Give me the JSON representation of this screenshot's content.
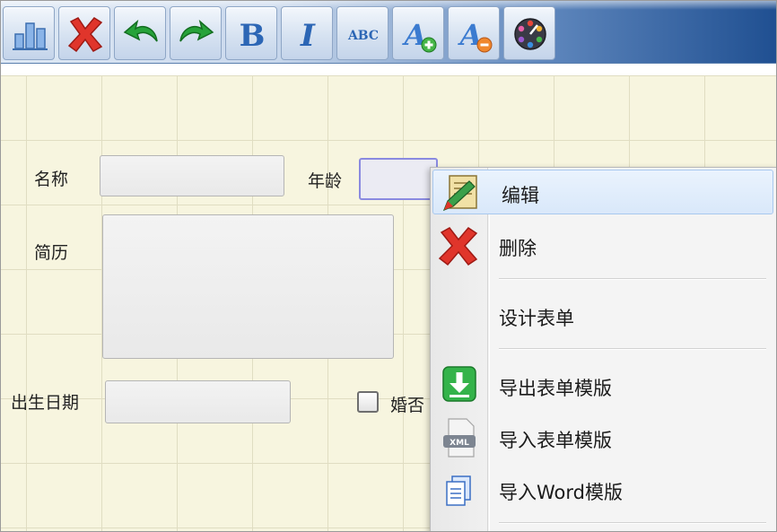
{
  "toolbar": {
    "buttons": [
      {
        "name": "chart-icon"
      },
      {
        "name": "delete-icon"
      },
      {
        "name": "undo-icon"
      },
      {
        "name": "redo-icon"
      },
      {
        "name": "bold-icon",
        "label": "B"
      },
      {
        "name": "italic-icon",
        "label": "I"
      },
      {
        "name": "spellcheck-icon",
        "label": "ABC"
      },
      {
        "name": "font-increase-icon",
        "label": "A"
      },
      {
        "name": "font-decrease-icon",
        "label": "A"
      },
      {
        "name": "color-picker-icon"
      }
    ]
  },
  "form": {
    "name_label": "名称",
    "age_label": "年龄",
    "resume_label": "简历",
    "birthdate_label": "出生日期",
    "married_label": "婚否"
  },
  "context_menu": {
    "items": [
      {
        "label": "编辑",
        "icon": "edit-icon"
      },
      {
        "label": "删除",
        "icon": "delete-icon"
      },
      {
        "label": "设计表单",
        "icon": ""
      },
      {
        "label": "导出表单模版",
        "icon": "export-icon"
      },
      {
        "label": "导入表单模版",
        "icon": "xml-import-icon"
      },
      {
        "label": "导入Word模版",
        "icon": "word-import-icon"
      }
    ]
  },
  "colors": {
    "canvas": "#f7f5df",
    "grid": "#e0ddc2",
    "toolbar_dark": "#1f4f91",
    "menu_highlight": "#d9e8fa"
  }
}
